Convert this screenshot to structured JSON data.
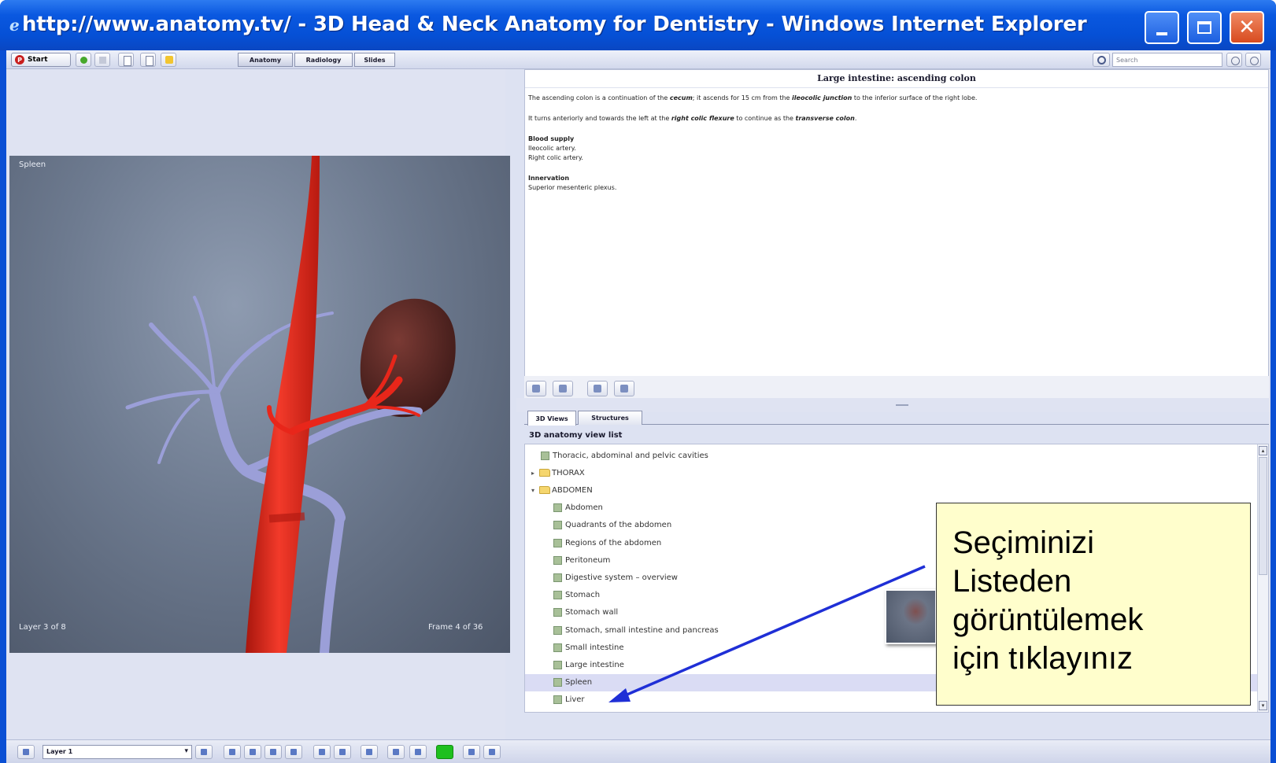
{
  "window": {
    "title": "http://www.anatomy.tv/ - 3D Head & Neck Anatomy for Dentistry - Windows Internet Explorer"
  },
  "toolbar": {
    "start_label": "Start",
    "tabs": [
      "Anatomy",
      "Radiology",
      "Slides"
    ],
    "search_placeholder": "Search"
  },
  "viewer": {
    "structure_label": "Spleen",
    "layer_info": "Layer 3 of 8",
    "frame_info": "Frame 4 of 36",
    "colors": {
      "background": "#6d7a8f",
      "artery": "#e8261a",
      "vein": "#9b9fd8",
      "spleen": "#5c2a26"
    }
  },
  "description": {
    "title": "Large intestine: ascending colon",
    "p1_a": "The ascending colon is a continuation of the ",
    "p1_cecum": "cecum",
    "p1_b": "; it ascends for 15 cm from the ",
    "p1_junction": "ileocolic junction",
    "p1_c": " to the inferior surface of the right lobe.",
    "p2_a": "It turns anteriorly and towards the left at the ",
    "p2_flexure": "right colic flexure",
    "p2_b": " to continue as the ",
    "p2_colon": "transverse colon",
    "p2_c": ".",
    "blood_heading": "Blood supply",
    "blood_1": "Ileocolic artery.",
    "blood_2": "Right colic artery.",
    "innervation_heading": "Innervation",
    "innervation_1": "Superior mesenteric plexus."
  },
  "panel_tabs": [
    "3D Views",
    "Structures"
  ],
  "list_heading": "3D anatomy view list",
  "views_list": {
    "items": [
      {
        "label": "Thoracic, abdominal and pelvic cavities",
        "type": "page",
        "indent": 1
      },
      {
        "label": "THORAX",
        "type": "folder",
        "toggle": "▸",
        "indent": 0
      },
      {
        "label": "ABDOMEN",
        "type": "folder",
        "toggle": "▾",
        "indent": 0
      },
      {
        "label": "Abdomen",
        "type": "page",
        "indent": 2
      },
      {
        "label": "Quadrants of the abdomen",
        "type": "page",
        "indent": 2
      },
      {
        "label": "Regions of the abdomen",
        "type": "page",
        "indent": 2
      },
      {
        "label": "Peritoneum",
        "type": "page",
        "indent": 2
      },
      {
        "label": "Digestive system – overview",
        "type": "page",
        "indent": 2
      },
      {
        "label": "Stomach",
        "type": "page",
        "indent": 2
      },
      {
        "label": "Stomach wall",
        "type": "page",
        "indent": 2
      },
      {
        "label": "Stomach, small intestine and pancreas",
        "type": "page",
        "indent": 2
      },
      {
        "label": "Small intestine",
        "type": "page",
        "indent": 2
      },
      {
        "label": "Large intestine",
        "type": "page",
        "indent": 2
      },
      {
        "label": "Spleen",
        "type": "page",
        "indent": 2,
        "selected": true
      },
      {
        "label": "Liver",
        "type": "page",
        "indent": 2
      }
    ]
  },
  "bottom_toolbar": {
    "layer_select": "Layer 1"
  },
  "callout": {
    "text": "Seçiminizi\nListeden\ngörüntülemek\niçin tıklayınız",
    "arrow_color": "#1f2fd6"
  }
}
